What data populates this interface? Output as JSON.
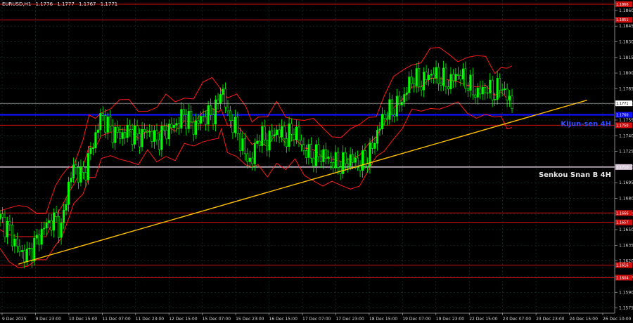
{
  "header": {
    "symbol": "EURUSD,H1",
    "open": "1.1776",
    "high": "1.1777",
    "low": "1.1767",
    "close": "1.1771"
  },
  "labels": {
    "kijun": "Kijun-sen 4H",
    "senkou": "Senkou Snan B 4H"
  },
  "colors": {
    "background": "#000000",
    "grid": "#1f3a3a",
    "candle_up": "#00ff00",
    "candle_down": "#00ff00",
    "bollinger": "#ff1a1a",
    "support_resistance": "#d01010",
    "kijun": "#1010ff",
    "kijun_label": "#3050ff",
    "senkou": "#d8c8d8",
    "trendline": "#ffc000",
    "current_price": "#c8c8c8"
  },
  "chart_data": {
    "type": "candlestick",
    "ylim": [
      1.157,
      1.187
    ],
    "y_ticks": [
      "1.1575",
      "1.1590",
      "1.1605",
      "1.1620",
      "1.1635",
      "1.1650",
      "1.1665",
      "1.1680",
      "1.1695",
      "1.1710",
      "1.1725",
      "1.1740",
      "1.1755",
      "1.1770",
      "1.1785",
      "1.1800",
      "1.1815",
      "1.1830",
      "1.1845",
      "1.1860"
    ],
    "x_ticks": [
      "9 Dec 2025",
      "9 Dec 23:00",
      "10 Dec 15:00",
      "11 Dec 07:00",
      "11 Dec 23:00",
      "12 Dec 15:00",
      "15 Dec 07:00",
      "15 Dec 23:00",
      "16 Dec 15:00",
      "17 Dec 07:00",
      "17 Dec 23:00",
      "18 Dec 15:00",
      "19 Dec 07:00",
      "19 Dec 23:00",
      "22 Dec 15:00",
      "23 Dec 07:00",
      "23 Dec 23:00",
      "24 Dec 15:00",
      "26 Dec 10:00"
    ],
    "levels": [
      {
        "value": 1.1866,
        "label": "1.1866",
        "kind": "resistance"
      },
      {
        "value": 1.1851,
        "label": "1.1851",
        "kind": "resistance"
      },
      {
        "value": 1.176,
        "label": "1.1760",
        "kind": "kijun"
      },
      {
        "value": 1.175,
        "label": "1.1750",
        "kind": "resistance"
      },
      {
        "value": 1.171,
        "label": "1.1710",
        "kind": "senkou"
      },
      {
        "value": 1.1666,
        "label": "1.1666",
        "kind": "resistance"
      },
      {
        "value": 1.1657,
        "label": "1.1657",
        "kind": "resistance"
      },
      {
        "value": 1.1616,
        "label": "1.1616",
        "kind": "resistance"
      },
      {
        "value": 1.1604,
        "label": "1.1604",
        "kind": "resistance"
      }
    ],
    "current_price": {
      "value": 1.1771,
      "label": "1.1771"
    },
    "trendline": {
      "start": {
        "x": 0.03,
        "value": 1.1617
      },
      "end": {
        "x": 0.955,
        "value": 1.1774
      }
    },
    "price_path": [
      [
        0.0,
        1.166
      ],
      [
        0.015,
        1.165
      ],
      [
        0.03,
        1.163
      ],
      [
        0.045,
        1.1625
      ],
      [
        0.06,
        1.164
      ],
      [
        0.075,
        1.1655
      ],
      [
        0.09,
        1.166
      ],
      [
        0.1,
        1.165
      ],
      [
        0.11,
        1.169
      ],
      [
        0.12,
        1.171
      ],
      [
        0.135,
        1.17
      ],
      [
        0.145,
        1.172
      ],
      [
        0.155,
        1.174
      ],
      [
        0.165,
        1.176
      ],
      [
        0.18,
        1.1745
      ],
      [
        0.195,
        1.174
      ],
      [
        0.21,
        1.1745
      ],
      [
        0.225,
        1.1738
      ],
      [
        0.24,
        1.1745
      ],
      [
        0.255,
        1.1735
      ],
      [
        0.27,
        1.1745
      ],
      [
        0.285,
        1.175
      ],
      [
        0.3,
        1.176
      ],
      [
        0.315,
        1.1748
      ],
      [
        0.33,
        1.1758
      ],
      [
        0.345,
        1.176
      ],
      [
        0.355,
        1.177
      ],
      [
        0.36,
        1.179
      ],
      [
        0.37,
        1.176
      ],
      [
        0.385,
        1.1745
      ],
      [
        0.4,
        1.172
      ],
      [
        0.41,
        1.1715
      ],
      [
        0.42,
        1.174
      ],
      [
        0.435,
        1.1735
      ],
      [
        0.45,
        1.1745
      ],
      [
        0.465,
        1.1738
      ],
      [
        0.48,
        1.1745
      ],
      [
        0.495,
        1.1725
      ],
      [
        0.51,
        1.172
      ],
      [
        0.525,
        1.1722
      ],
      [
        0.54,
        1.1715
      ],
      [
        0.555,
        1.1712
      ],
      [
        0.57,
        1.1718
      ],
      [
        0.585,
        1.1712
      ],
      [
        0.6,
        1.172
      ],
      [
        0.612,
        1.174
      ],
      [
        0.625,
        1.176
      ],
      [
        0.64,
        1.1765
      ],
      [
        0.655,
        1.1775
      ],
      [
        0.67,
        1.1795
      ],
      [
        0.685,
        1.179
      ],
      [
        0.7,
        1.18
      ],
      [
        0.715,
        1.1795
      ],
      [
        0.73,
        1.179
      ],
      [
        0.745,
        1.18
      ],
      [
        0.76,
        1.179
      ],
      [
        0.775,
        1.178
      ],
      [
        0.79,
        1.1785
      ],
      [
        0.805,
        1.178
      ],
      [
        0.815,
        1.179
      ],
      [
        0.825,
        1.1776
      ],
      [
        0.833,
        1.1771
      ]
    ]
  }
}
